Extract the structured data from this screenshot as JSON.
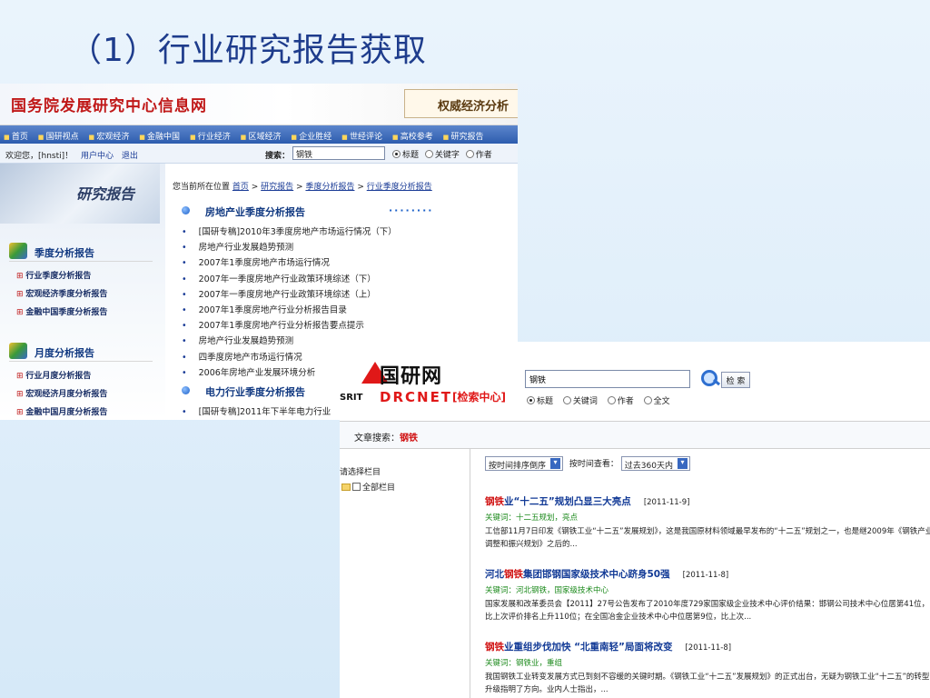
{
  "slide": {
    "title": "（1）行业研究报告获取"
  },
  "s1": {
    "site_logo": "国务院发展研究中心信息网",
    "authority": "权威经济分析",
    "nav": [
      "首页",
      "国研视点",
      "宏观经济",
      "金融中国",
      "行业经济",
      "区域经济",
      "企业胜经",
      "世经评论",
      "高校参考",
      "研究报告"
    ],
    "welcome": "欢迎您，[hnsti]！",
    "user_center": "用户中心",
    "logout": "退出",
    "search_label": "搜索：",
    "search_value": "钢铁",
    "radios": [
      "标题",
      "关键字",
      "作者"
    ],
    "banner": "研究报告",
    "side_quarter": {
      "title": "季度分析报告",
      "items": [
        "行业季度分析报告",
        "宏观经济季度分析报告",
        "金融中国季度分析报告"
      ]
    },
    "side_month": {
      "title": "月度分析报告",
      "items": [
        "行业月度分析报告",
        "宏观经济月度分析报告",
        "金融中国月度分析报告"
      ]
    },
    "crumb": {
      "prefix": "您当前所在位置",
      "c1": "首页",
      "c2": "研究报告",
      "c3": "季度分析报告",
      "c4": "行业季度分析报告"
    },
    "cat1": {
      "title": "房地产业季度分析报告",
      "items": [
        "[国研专稿]2010年3季度房地产市场运行情况（下）",
        "房地产行业发展趋势预测",
        "2007年1季度房地产市场运行情况",
        "2007年一季度房地产行业政策环境综述（下）",
        "2007年一季度房地产行业政策环境综述（上）",
        "2007年1季度房地产行业分析报告目录",
        "2007年1季度房地产行业分析报告要点提示",
        "房地产行业发展趋势预测",
        "四季度房地产市场运行情况",
        "2006年房地产业发展环境分析"
      ]
    },
    "cat2": {
      "title": "电力行业季度分析报告",
      "items": [
        "[国研专稿]2011年下半年电力行业"
      ]
    }
  },
  "s2": {
    "logo_cn": "国研网",
    "logo_srit": "SRIT",
    "logo_en": "DRCNET",
    "logo_sub": "[检索中心]",
    "search_value": "钢铁",
    "search_button": "检 索",
    "radios": [
      "标题",
      "关键词",
      "作者",
      "全文"
    ],
    "article_search_label": "文章搜索：",
    "article_search_term": "钢铁",
    "left_title": "请选择栏目",
    "left_all": "全部栏目",
    "sort_option": "按时间排序倒序",
    "time_label": "按时间查看：",
    "time_option": "过去360天内",
    "results": [
      {
        "hl": "钢铁",
        "title": "业“十二五”规划凸显三大亮点",
        "date": "[2011-11-9]",
        "keywords": "关键词：十二五规划，亮点",
        "abstract": "工信部11月7日印发《钢铁工业“十二五”发展规划》，这是我国原材料领域最早发布的“十二五”规划之一，也是继2009年《钢铁产业调整和振兴规划》之后的..."
      },
      {
        "pre": "河北",
        "hl": "钢铁",
        "title": "集团邯钢国家级技术中心跻身50强",
        "date": "[2011-11-8]",
        "keywords": "关键词：河北钢铁，国家级技术中心",
        "abstract": "国家发展和改革委员会【2011】27号公告发布了2010年度729家国家级企业技术中心评价结果：邯钢公司技术中心位居第41位，比上次评价排名上升110位；在全国冶金企业技术中心中位居第9位，比上次..."
      },
      {
        "hl": "钢铁",
        "title": "业重组步伐加快 “北重南轻”局面将改变",
        "date": "[2011-11-8]",
        "keywords": "关键词：钢铁业，重组",
        "abstract": "我国钢铁工业转变发展方式已到刻不容缓的关键时期。《钢铁工业“十二五”发展规划》的正式出台，无疑为钢铁工业“十二五”的转型升级指明了方向。业内人士指出，..."
      }
    ]
  }
}
